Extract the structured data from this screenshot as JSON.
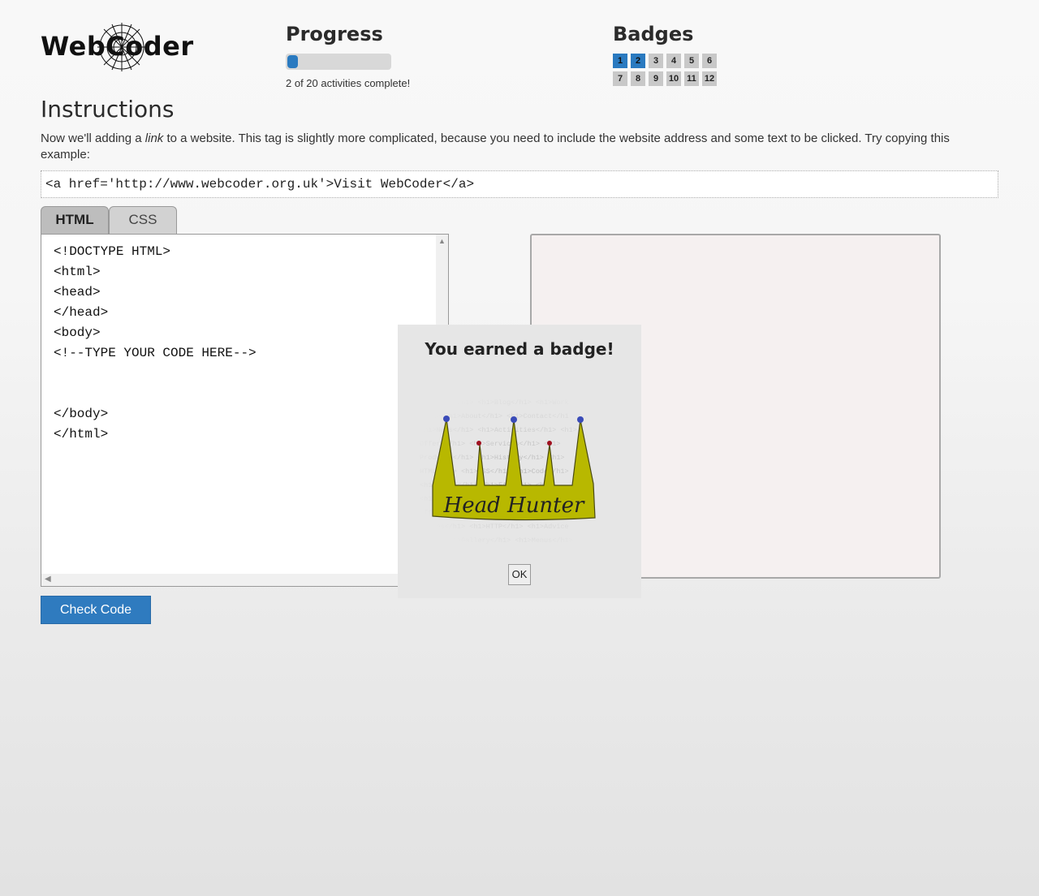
{
  "logo": {
    "text": "WebCoder"
  },
  "progress": {
    "title": "Progress",
    "completed": 2,
    "total": 20,
    "text": "2 of 20 activities complete!"
  },
  "badges": {
    "title": "Badges",
    "items": [
      {
        "label": "1",
        "earned": true
      },
      {
        "label": "2",
        "earned": true
      },
      {
        "label": "3",
        "earned": false
      },
      {
        "label": "4",
        "earned": false
      },
      {
        "label": "5",
        "earned": false
      },
      {
        "label": "6",
        "earned": false
      },
      {
        "label": "7",
        "earned": false
      },
      {
        "label": "8",
        "earned": false
      },
      {
        "label": "9",
        "earned": false
      },
      {
        "label": "10",
        "earned": false
      },
      {
        "label": "11",
        "earned": false
      },
      {
        "label": "12",
        "earned": false
      }
    ]
  },
  "instructions": {
    "title": "Instructions",
    "text_before": "Now we'll adding a ",
    "text_italic": "link",
    "text_after": " to a website. This tag is slightly more complicated, because you need to include the website address and some text to be clicked. Try copying this example:",
    "example": "<a href='http://www.webcoder.org.uk'>Visit WebCoder</a>"
  },
  "tabs": [
    {
      "label": "HTML",
      "active": true
    },
    {
      "label": "CSS",
      "active": false
    }
  ],
  "editor": {
    "code": "<!DOCTYPE HTML>\n<html>\n<head>\n</head>\n<body>\n<!--TYPE YOUR CODE HERE-->\n\n\n</body>\n</html>"
  },
  "check_button": "Check Code",
  "modal": {
    "title": "You earned a badge!",
    "badge_name": "Head Hunter",
    "ok": "OK"
  },
  "colors": {
    "accent": "#2a7ac0",
    "crown": "#b8b800"
  }
}
